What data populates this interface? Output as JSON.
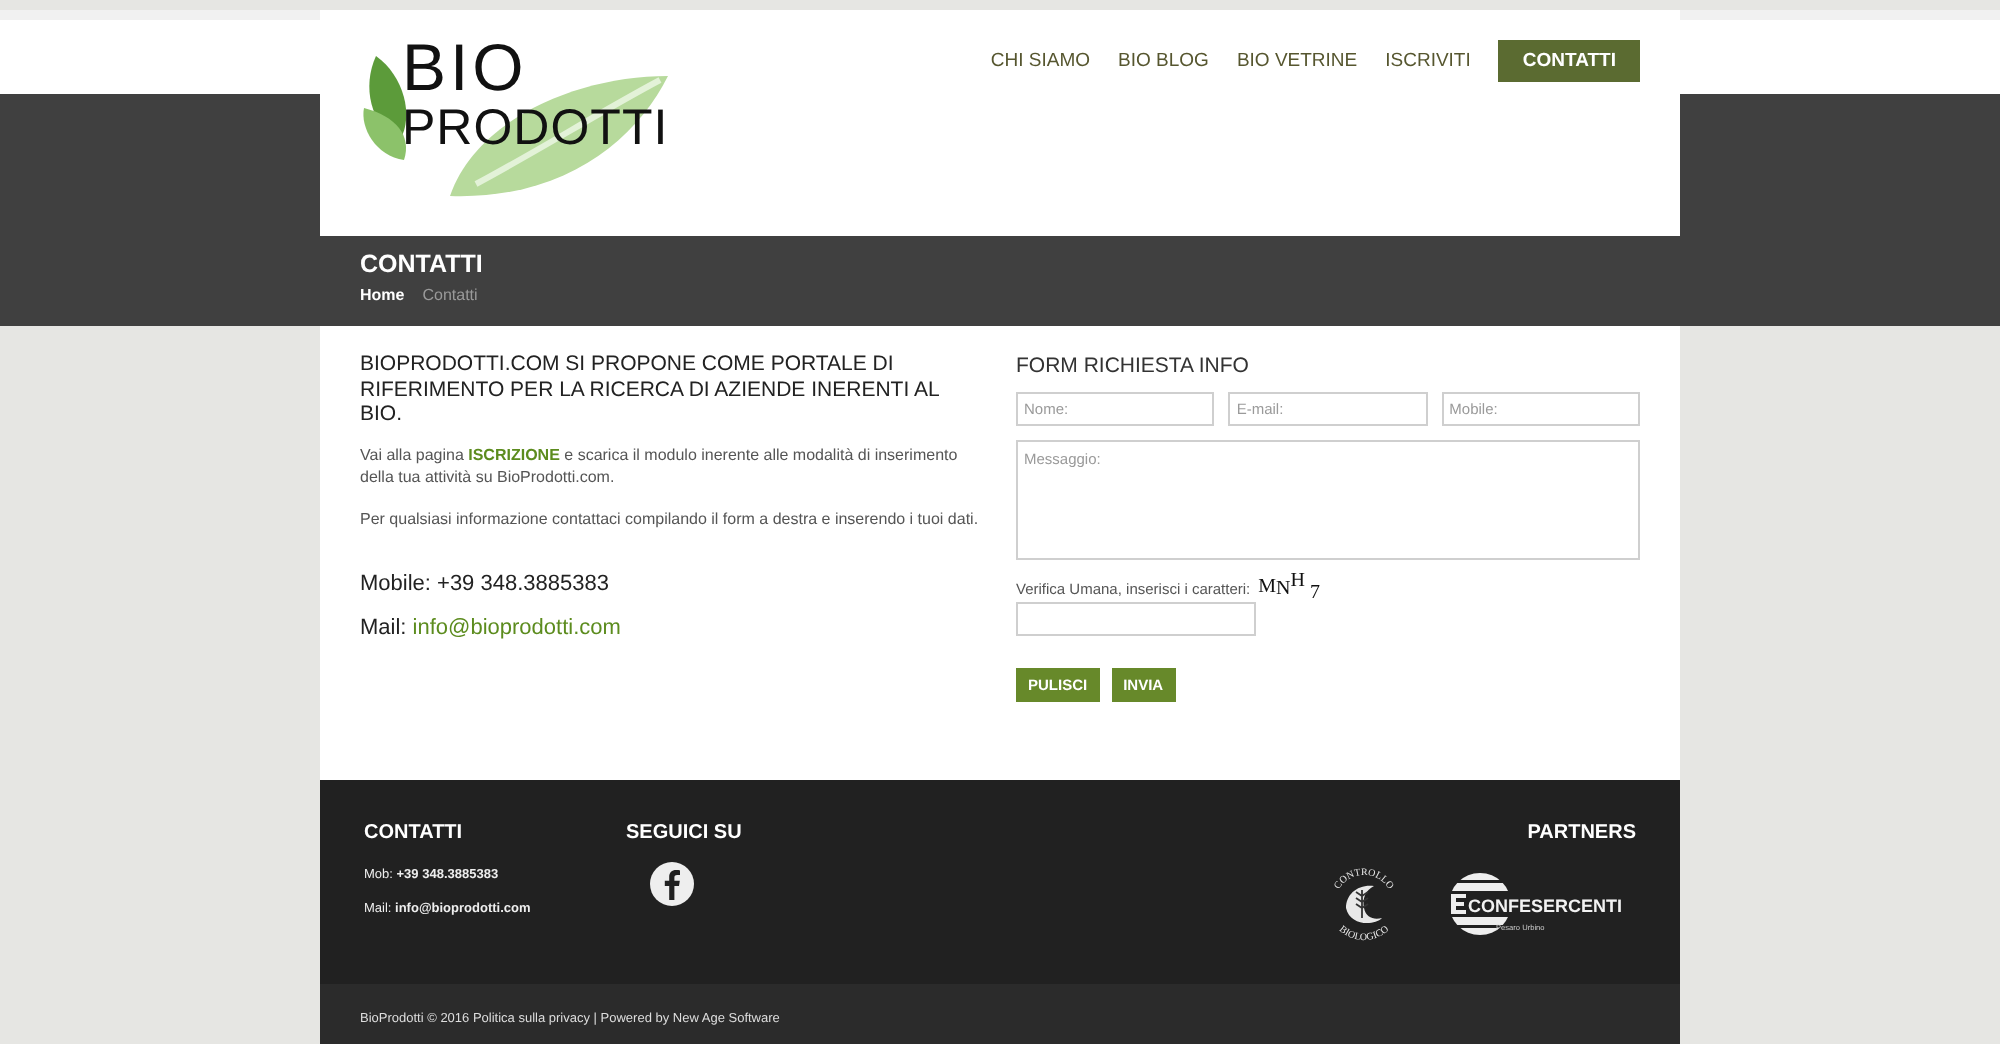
{
  "header": {
    "logo": {
      "line1": "BIO",
      "line2": "PRODOTTI"
    },
    "nav": [
      {
        "label": "CHI SIAMO",
        "selected": false
      },
      {
        "label": "BIO BLOG",
        "selected": false
      },
      {
        "label": "BIO VETRINE",
        "selected": false
      },
      {
        "label": "ISCRIVITI",
        "selected": false
      },
      {
        "label": "CONTATTI",
        "selected": true
      }
    ]
  },
  "page_title": {
    "title": "CONTATTI",
    "breadcrumb": [
      {
        "label": "Home",
        "current": false
      },
      {
        "label": "Contatti",
        "current": true
      }
    ]
  },
  "intro": {
    "heading": "BIOPRODOTTI.COM SI PROPONE COME PORTALE DI RIFERIMENTO PER LA RICERCA DI AZIENDE INERENTI AL BIO.",
    "signup_note": {
      "before": "Vai alla pagina",
      "link": "ISCRIZIONE",
      "after": "e scarica il modulo inerente alle modalità di inserimento della tua attività su BioProdotti.com."
    },
    "contact_note": "Per qualsiasi informazione contattaci compilando il form a destra e inserendo i tuoi dati.",
    "mobile": "Mobile: +39 348.3885383",
    "mail": {
      "label": "Mail:",
      "link": "info@bioprodotti.com"
    }
  },
  "form": {
    "title": "FORM RICHIESTA INFO",
    "fields": [
      {
        "placeholder": "Nome:"
      },
      {
        "placeholder": "E-mail:"
      },
      {
        "placeholder": "Mobile:"
      }
    ],
    "message": {
      "placeholder": "Messaggio:"
    },
    "captcha": {
      "label": "Verifica Umana, inserisci i caratteri:",
      "characters": "MNH 7"
    },
    "buttons": [
      "PULISCI",
      "INVIA"
    ]
  },
  "footer": {
    "contacts": {
      "heading": "CONTATTI",
      "lines": [
        "Mob: **+39 348.3885383**",
        "Mail: **info@bioprodotti.com**"
      ]
    },
    "social": {
      "heading": "SEGUICI SU"
    },
    "partners": {
      "heading": "PARTNERS",
      "logos": [
        {
          "kind": "seal",
          "top_text": "CONTROLLO",
          "bottom_text": "BIOLOGICO"
        },
        {
          "kind": "emblem",
          "name": "CONFESERCENTI",
          "subtitle": "Pesaro Urbino"
        }
      ]
    }
  },
  "copyright": "BioProdotti © 2016 Politica sulla privacy | Powered by New Age Software"
}
